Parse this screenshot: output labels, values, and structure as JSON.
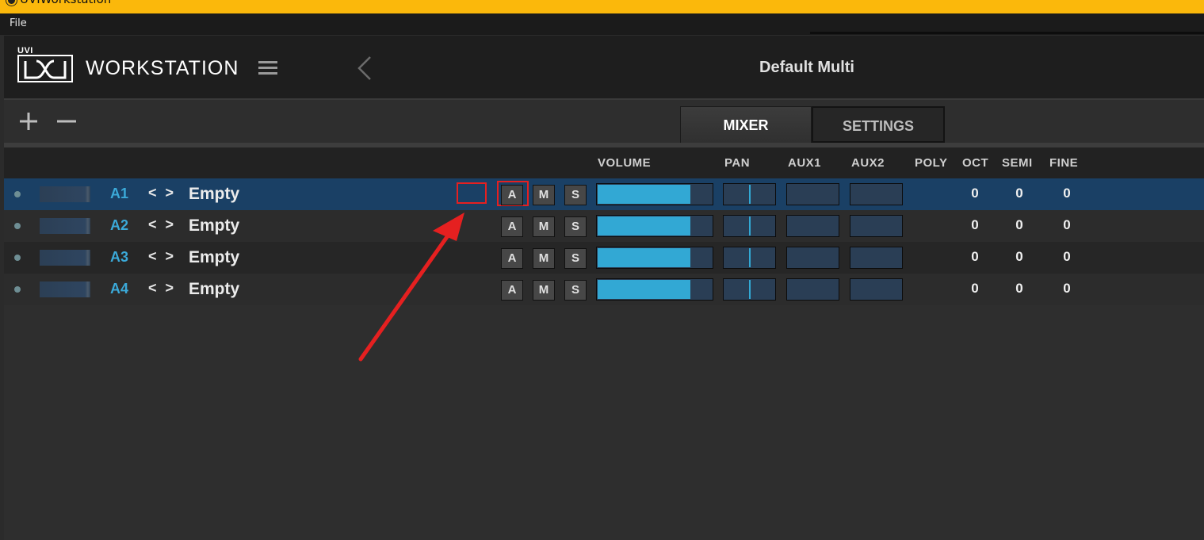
{
  "window": {
    "title": "UVIWorkstation"
  },
  "menubar": {
    "file": "File"
  },
  "header": {
    "logo_text": "UVI",
    "brand": "WORKSTATION",
    "multi_name": "Default Multi"
  },
  "toolbar": {
    "add_label": "+",
    "remove_label": "−",
    "tabs": [
      {
        "label": "MIXER",
        "active": true
      },
      {
        "label": "SETTINGS",
        "active": false
      }
    ]
  },
  "columns": {
    "volume": "VOLUME",
    "pan": "PAN",
    "aux1": "AUX1",
    "aux2": "AUX2",
    "poly": "POLY",
    "oct": "OCT",
    "semi": "SEMI",
    "fine": "FINE"
  },
  "buttons": {
    "a": "A",
    "m": "M",
    "s": "S",
    "nav": "< >"
  },
  "parts": [
    {
      "id": "A1",
      "name": "Empty",
      "volume_fraction": 0.8,
      "pan_fraction": 0.5,
      "oct": "0",
      "semi": "0",
      "fine": "0",
      "selected": true
    },
    {
      "id": "A2",
      "name": "Empty",
      "volume_fraction": 0.8,
      "pan_fraction": 0.5,
      "oct": "0",
      "semi": "0",
      "fine": "0",
      "selected": false
    },
    {
      "id": "A3",
      "name": "Empty",
      "volume_fraction": 0.8,
      "pan_fraction": 0.5,
      "oct": "0",
      "semi": "0",
      "fine": "0",
      "selected": false
    },
    {
      "id": "A4",
      "name": "Empty",
      "volume_fraction": 0.8,
      "pan_fraction": 0.5,
      "oct": "0",
      "semi": "0",
      "fine": "0",
      "selected": false
    }
  ],
  "colors": {
    "titlebar": "#fbb80b",
    "accent": "#32a8d4",
    "part_id": "#3ba9d8",
    "selected_row": "#1a4065",
    "annotation": "#e52020"
  },
  "icons": {
    "menu": "hamburger-icon",
    "back": "chevron-left-icon",
    "add": "plus-icon",
    "remove": "minus-icon",
    "annotation": "red-arrow"
  }
}
